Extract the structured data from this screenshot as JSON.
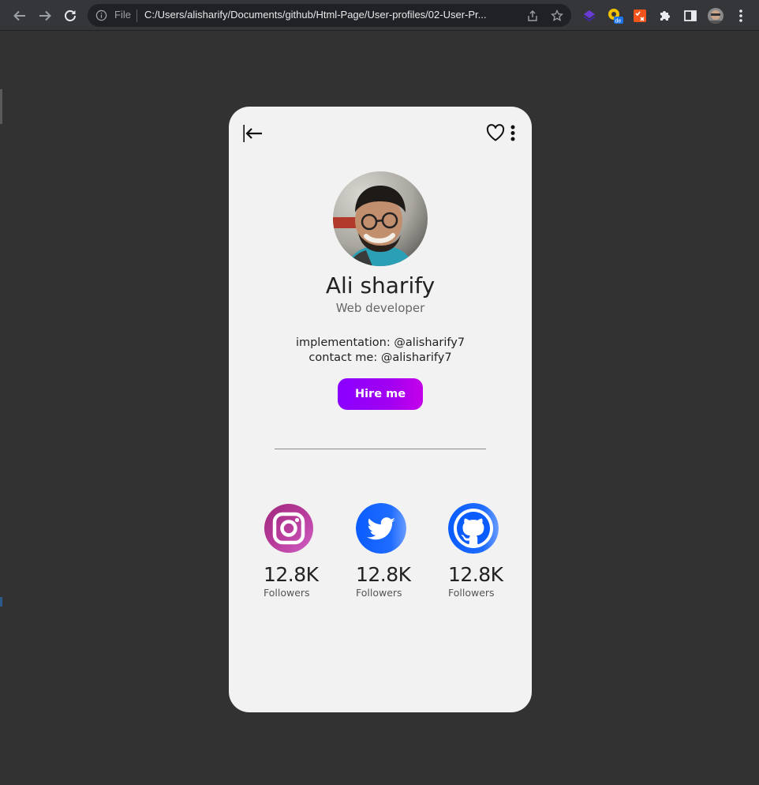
{
  "browser": {
    "protocol_label": "File",
    "url": "C:/Users/alisharify/Documents/github/Html-Page/User-profiles/02-User-Pr..."
  },
  "profile": {
    "name": "Ali sharify",
    "role": "Web developer",
    "implementation": "implementation: @alisharify7",
    "contact": "contact me: @alisharify7",
    "hire_label": "Hire me"
  },
  "socials": [
    {
      "icon": "instagram-icon",
      "count": "12.8K",
      "label": "Followers"
    },
    {
      "icon": "twitter-icon",
      "count": "12.8K",
      "label": "Followers"
    },
    {
      "icon": "github-icon",
      "count": "12.8K",
      "label": "Followers"
    }
  ],
  "colors": {
    "page_bg": "#323232",
    "card_bg": "#f2f2f2",
    "hire_gradient_start": "#8a00ff",
    "hire_gradient_end": "#c400ea",
    "social_blue": "#0a5cff"
  }
}
